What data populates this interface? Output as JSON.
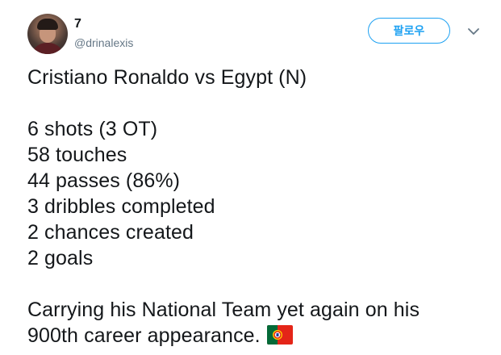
{
  "tweet": {
    "display_name": "7",
    "handle": "@drinalexis",
    "follow_label": "팔로우",
    "icons": {
      "avatar": "profile-avatar",
      "caret": "chevron-down-icon",
      "flag": "portugal-flag-icon"
    },
    "colors": {
      "accent": "#1da1f2",
      "text": "#14171a",
      "muted": "#657786"
    },
    "text": {
      "title": "Cristiano Ronaldo vs Egypt (N)",
      "stats": [
        "6 shots (3 OT)",
        "58 touches",
        "44 passes (86%)",
        "3 dribbles completed",
        "2 chances created",
        "2 goals"
      ],
      "closing_line_1": "Carrying his National Team yet again on his",
      "closing_line_2": "900th career appearance."
    }
  }
}
